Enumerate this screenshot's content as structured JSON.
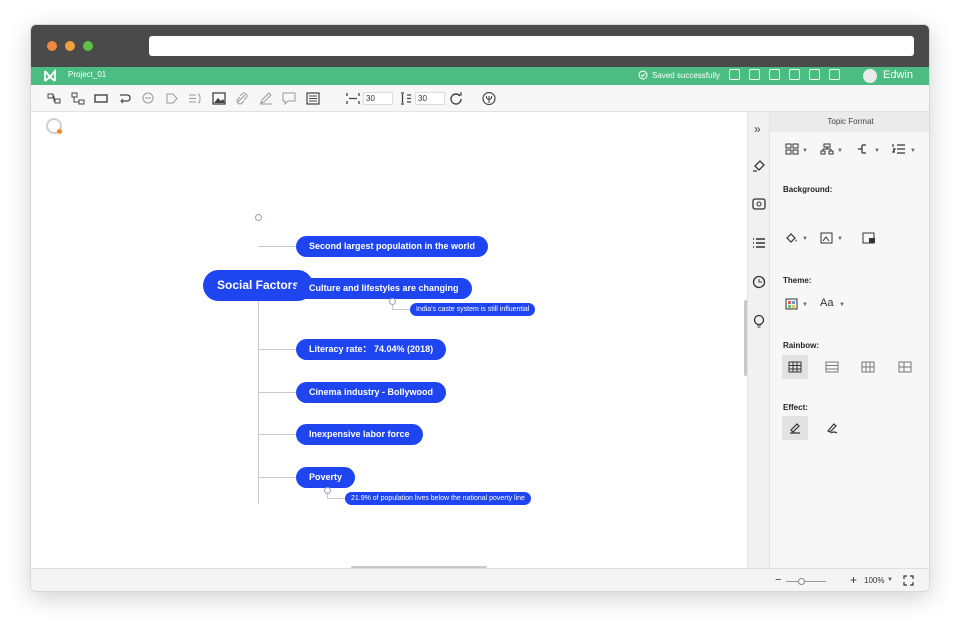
{
  "colors": {
    "brand_green": "#4cbd82",
    "node_blue": "#1f45f0",
    "titlebar": "#4a4a4a"
  },
  "window_controls": [
    "close-dot",
    "minimize-dot",
    "maximize-dot"
  ],
  "header": {
    "project": "Project_01",
    "saved_status": "Saved successfully",
    "user": "Edwin"
  },
  "toolbar": {
    "width_value": "30",
    "height_value": "30"
  },
  "mindmap": {
    "main": "Social Factors",
    "topics": [
      {
        "label": "Second largest population in the world"
      },
      {
        "label": "Culture and lifestyles are changing",
        "sub": "India's caste system is still influential"
      },
      {
        "label": "Literacy rate： 74.04% (2018)"
      },
      {
        "label": "Cinema industry - Bollywood"
      },
      {
        "label": "Inexpensive labor force"
      },
      {
        "label": "Poverty",
        "sub": "21.9% of population lives below the national poverty line"
      }
    ]
  },
  "panel": {
    "title": "Topic Format",
    "background_label": "Background:",
    "theme_label": "Theme:",
    "theme_font": "Aa",
    "rainbow_label": "Rainbow:",
    "effect_label": "Effect:"
  },
  "statusbar": {
    "zoom": "100%"
  }
}
